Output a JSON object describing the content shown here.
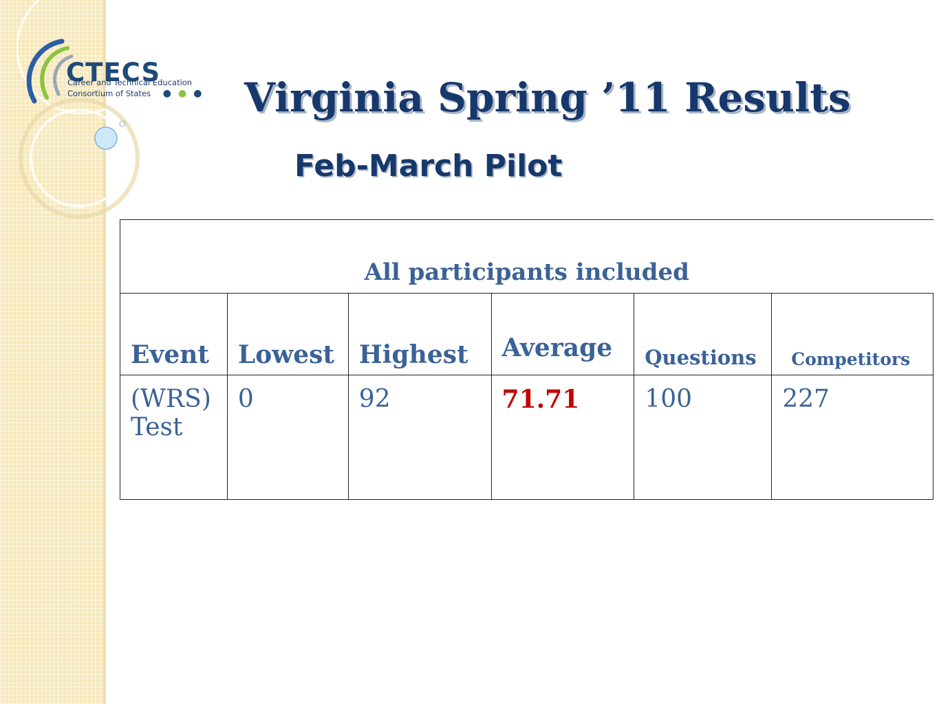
{
  "logo": {
    "name": "CTECS",
    "line1": "Career and Technical Education",
    "line2": "Consortium of States",
    "accent_colors": [
      "#2b5ea7",
      "#8bc53f",
      "#1f4a78"
    ]
  },
  "title": "Virginia Spring ’11 Results",
  "subtitle": "Feb-March Pilot",
  "table": {
    "caption": "All participants included",
    "headers": [
      "Event",
      "Lowest",
      "Highest",
      "Average",
      "Questions",
      "Competitors"
    ],
    "row": {
      "event": "(WRS) Test",
      "lowest": "0",
      "highest": "92",
      "average": "71.71",
      "questions": "100",
      "competitors": "227"
    }
  },
  "colors": {
    "title": "#17386b",
    "table_text": "#3a6296",
    "highlight": "#c00000",
    "sidebar": "#f6e7b8"
  }
}
